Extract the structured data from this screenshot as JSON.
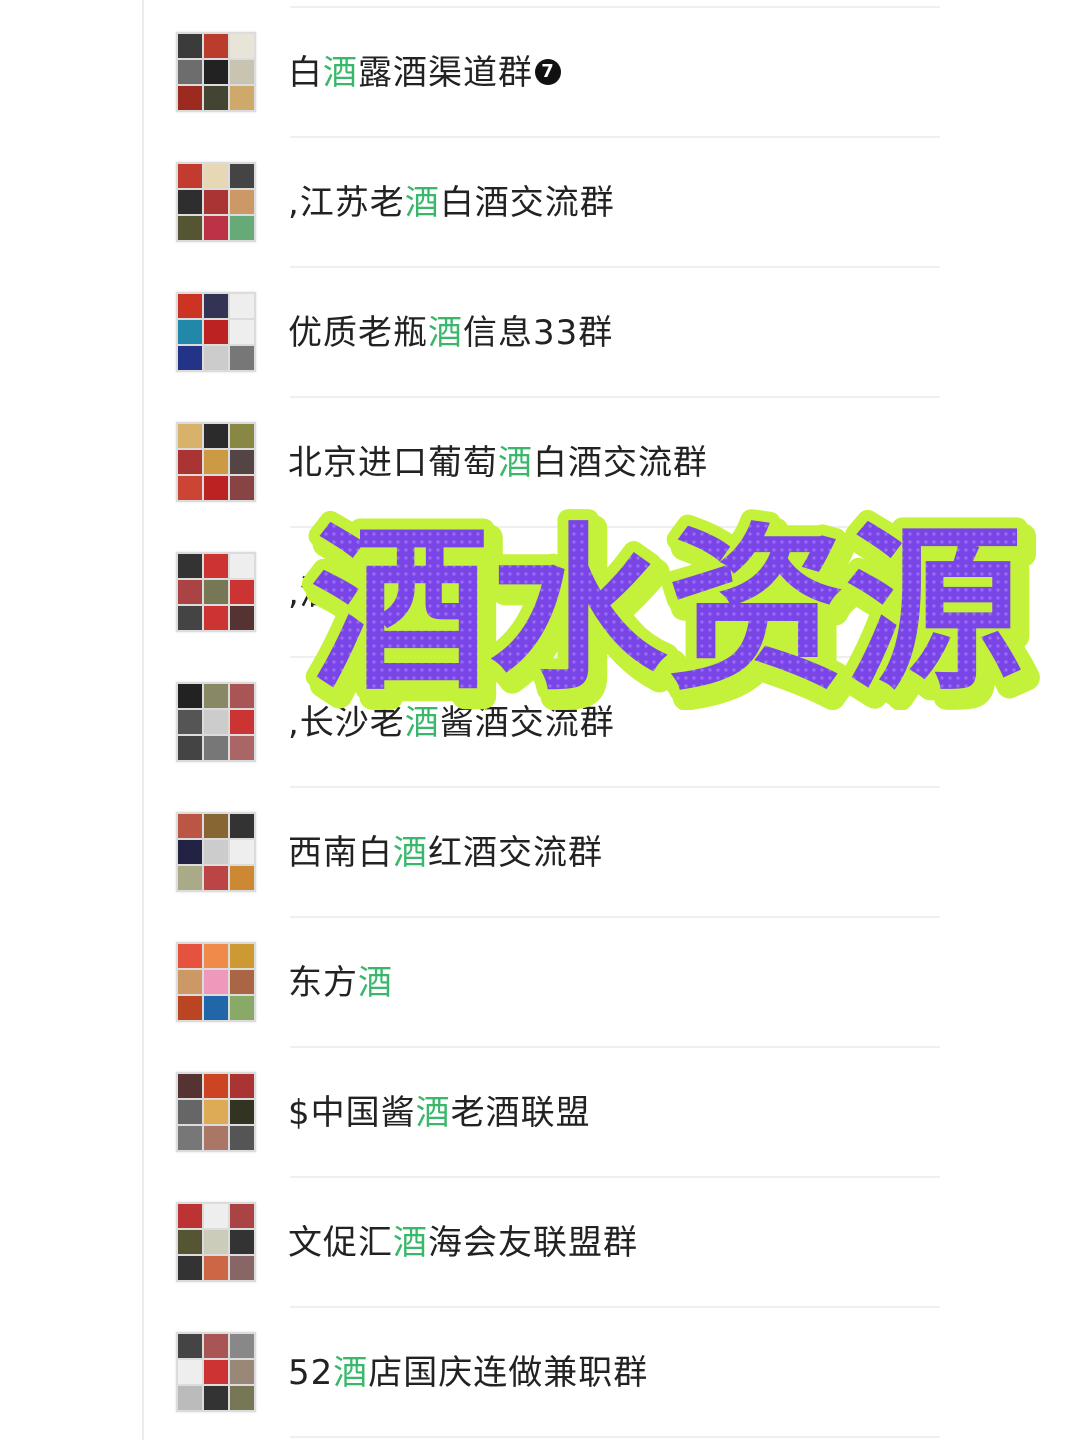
{
  "groups": [
    {
      "pre": "白",
      "hl": "酒",
      "post": "露酒渠道群",
      "badge": "7"
    },
    {
      "pre": ",江苏老",
      "hl": "酒",
      "post": "白酒交流群",
      "badge": ""
    },
    {
      "pre": "优质老瓶",
      "hl": "酒",
      "post": "信息33群",
      "badge": ""
    },
    {
      "pre": "北京进口葡萄",
      "hl": "酒",
      "post": "白酒交流群",
      "badge": ""
    },
    {
      "pre": ",",
      "hl": "",
      "post": "酒",
      "badge": ""
    },
    {
      "pre": ",长沙老",
      "hl": "酒",
      "post": "酱酒交流群",
      "badge": ""
    },
    {
      "pre": "西南白",
      "hl": "酒",
      "post": "红酒交流群",
      "badge": ""
    },
    {
      "pre": "东方",
      "hl": "酒",
      "post": "",
      "badge": ""
    },
    {
      "pre": "$中国酱",
      "hl": "酒",
      "post": "老酒联盟",
      "badge": ""
    },
    {
      "pre": "文促汇",
      "hl": "酒",
      "post": "海会友联盟群",
      "badge": ""
    },
    {
      "pre": "52",
      "hl": "酒",
      "post": "店国庆连做兼职群",
      "badge": ""
    }
  ],
  "overlay": {
    "text": "酒水资源",
    "fill_color": "#7a45e6",
    "outline_color": "#c4f23a"
  },
  "colors": {
    "highlight": "#39b86b",
    "text": "#222222",
    "divider": "#efefef"
  }
}
